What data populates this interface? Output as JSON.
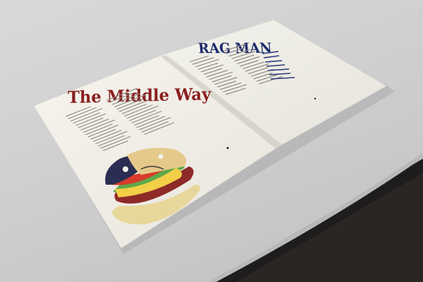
{
  "photo": {
    "subject": "open magazine on a white tablecloth",
    "left_page": {
      "headline": "The Middle Way",
      "illustration": "hamburger-illustration"
    },
    "right_page": {
      "headline": "RAG MAN"
    },
    "colors": {
      "tablecloth": "#d4d4d5",
      "paper": "#f3f1ea",
      "headline_left": "#8a1f1f",
      "headline_right": "#1d2a6b"
    }
  }
}
